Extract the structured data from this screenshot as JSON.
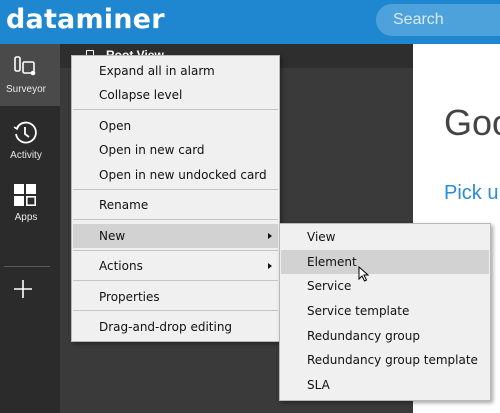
{
  "app": {
    "logo": "dataminer"
  },
  "search": {
    "placeholder": "Search"
  },
  "sidebar": {
    "items": [
      {
        "label": "Surveyor",
        "icon": "surveyor-icon",
        "active": true
      },
      {
        "label": "Activity",
        "icon": "clock-icon"
      },
      {
        "label": "Apps",
        "icon": "apps-grid-icon"
      }
    ],
    "add_icon": "plus-icon"
  },
  "panel": {
    "title": "Root View"
  },
  "content": {
    "greeting": "Good",
    "pick": "Pick u"
  },
  "context_menu": {
    "items": [
      {
        "label": "Expand all in alarm"
      },
      {
        "label": "Collapse level"
      },
      {
        "label": "Open"
      },
      {
        "label": "Open in new card"
      },
      {
        "label": "Open in new undocked card"
      },
      {
        "label": "Rename"
      },
      {
        "label": "New",
        "submenu": true,
        "highlighted": true
      },
      {
        "label": "Actions",
        "submenu": true
      },
      {
        "label": "Properties"
      },
      {
        "label": "Drag-and-drop editing"
      }
    ]
  },
  "submenu": {
    "items": [
      {
        "label": "View"
      },
      {
        "label": "Element",
        "highlighted": true
      },
      {
        "label": "Service"
      },
      {
        "label": "Service template"
      },
      {
        "label": "Redundancy group"
      },
      {
        "label": "Redundancy group template"
      },
      {
        "label": "SLA"
      }
    ]
  },
  "colors": {
    "topbar": "#1e87cf",
    "sidebar": "#2b2b2b",
    "panel": "#3a3a3a",
    "menu_bg": "#f0f0f0",
    "menu_highlight": "#d2d2d2",
    "link": "#2a8bd6"
  }
}
